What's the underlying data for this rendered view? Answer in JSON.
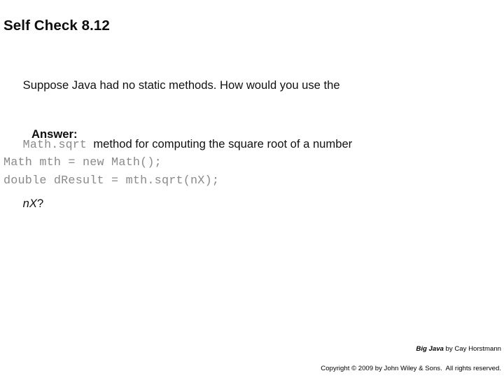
{
  "slide": {
    "title": "Self Check 8.12",
    "question": {
      "line1": "Suppose Java had no static methods. How would you use the",
      "inline_code": "Math.sqrt",
      "line2_rest": "method for computing the square root of a number",
      "variable": "nX",
      "line3_rest": "?"
    },
    "answer_label": "Answer:",
    "code": [
      "Math mth = new Math();",
      "double dResult = mth.sqrt(nX);"
    ],
    "footer": {
      "book_title": "Big Java",
      "attribution": " by Cay Horstmann",
      "copyright": "Copyright © 2009 by John Wiley & Sons.  All rights reserved."
    },
    "colors": {
      "background": "#ffffff",
      "body_text": "#111111",
      "code_text": "#8a8a8a",
      "title_text": "#0d0d0d"
    }
  }
}
